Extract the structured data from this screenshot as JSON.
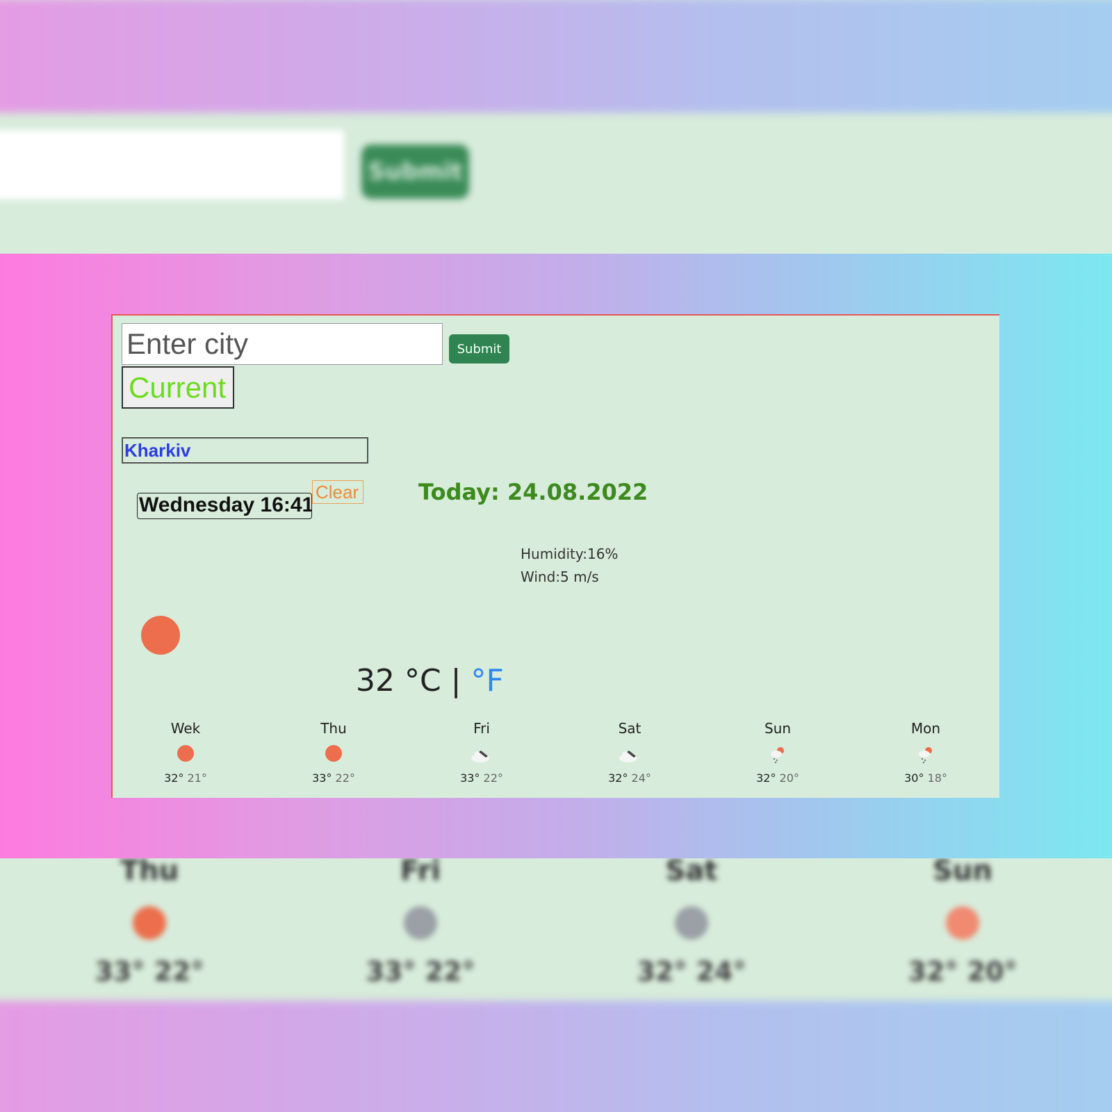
{
  "search": {
    "placeholder": "Enter city",
    "submit_label": "Submit",
    "current_label": "Current"
  },
  "weather": {
    "city": "Kharkiv",
    "datetime": "Wednesday 16:41",
    "clear_label": "Clear",
    "today": "Today: 24.08.2022",
    "humidity": "Humidity:16%",
    "wind": "Wind:5 m/s",
    "temp_c": "32 °C |",
    "unit_f": "°F",
    "icon": "sun-icon"
  },
  "forecast": [
    {
      "day": "Wek",
      "icon": "sun-icon",
      "hi": "32°",
      "lo": "21°"
    },
    {
      "day": "Thu",
      "icon": "sun-icon",
      "hi": "33°",
      "lo": "22°"
    },
    {
      "day": "Fri",
      "icon": "cloud-icon",
      "hi": "33°",
      "lo": "22°"
    },
    {
      "day": "Sat",
      "icon": "cloud-icon",
      "hi": "32°",
      "lo": "24°"
    },
    {
      "day": "Sun",
      "icon": "rain-sun-icon",
      "hi": "32°",
      "lo": "20°"
    },
    {
      "day": "Mon",
      "icon": "rain-sun-icon",
      "hi": "30°",
      "lo": "18°"
    }
  ],
  "colors": {
    "accent_green": "#2f8451",
    "sun": "#ec6e4c",
    "city_text": "#2a3ee3",
    "today_text": "#3d8a1e",
    "fahrenheit_link": "#2f86f0"
  }
}
